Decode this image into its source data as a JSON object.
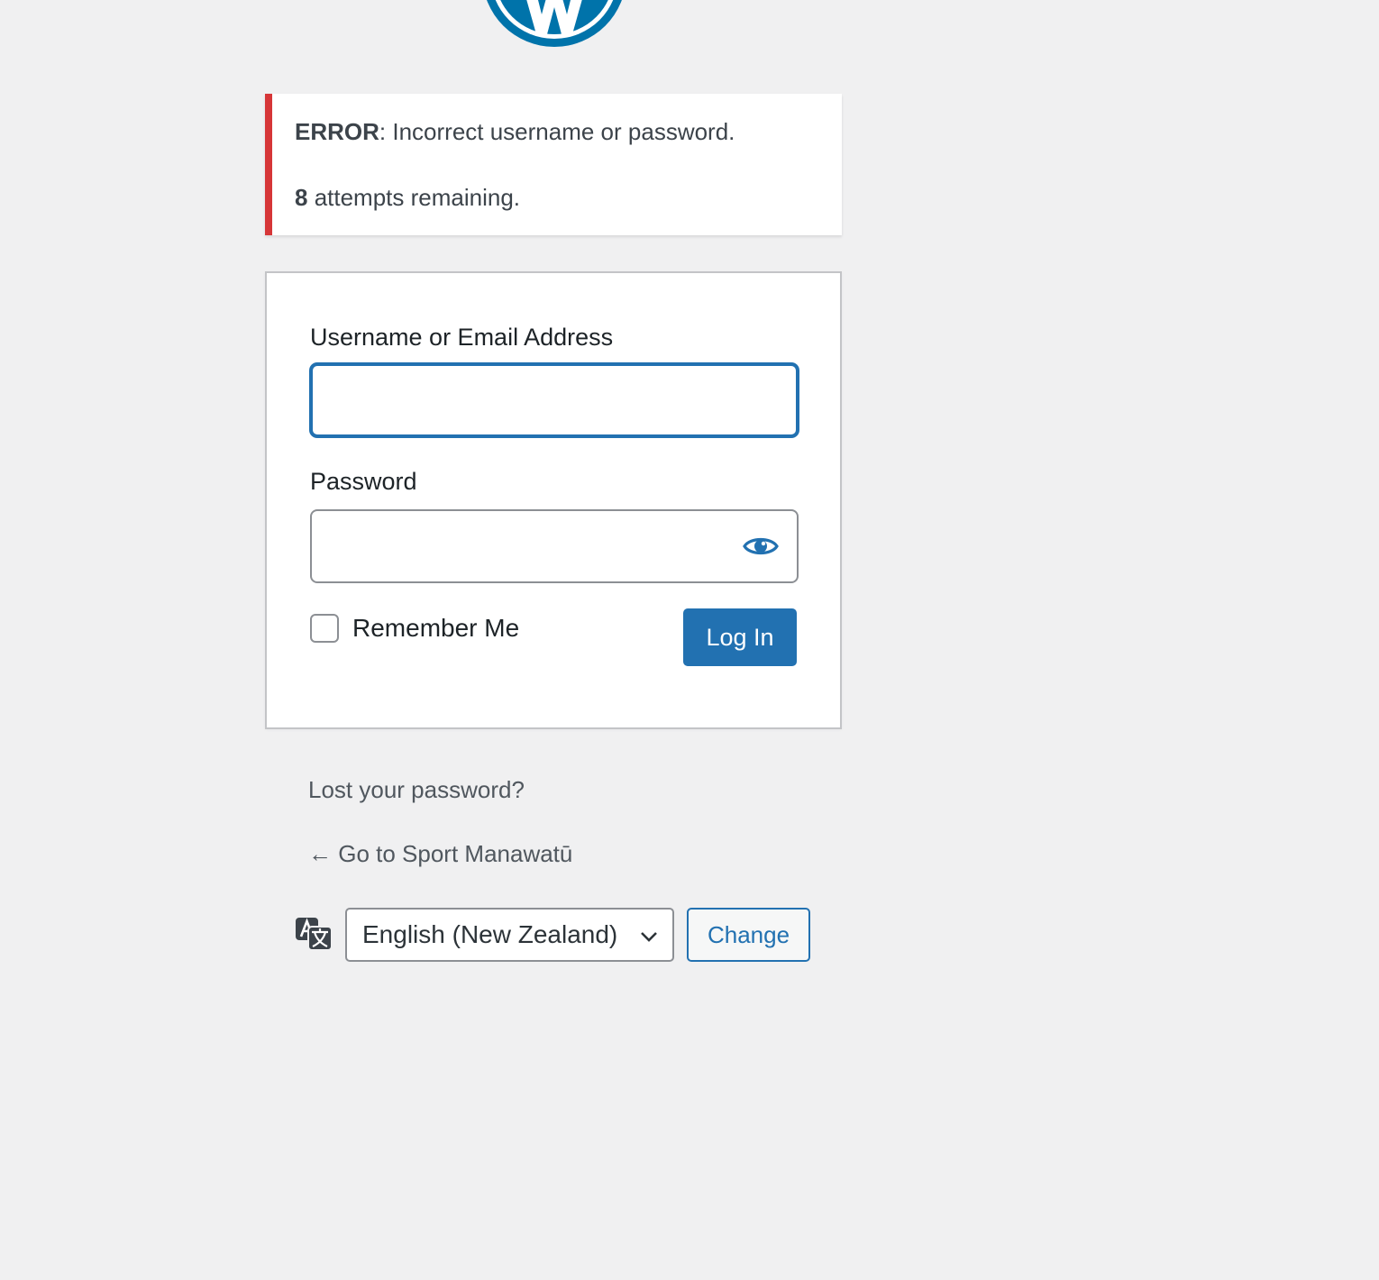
{
  "logo": {
    "icon": "wordpress-logo-icon",
    "color": "#0073aa"
  },
  "notice": {
    "error_label": "ERROR",
    "error_message": ": Incorrect username or password.",
    "attempts_count": "8",
    "attempts_text": " attempts remaining.",
    "accent_color": "#d63638"
  },
  "form": {
    "username_label": "Username or Email Address",
    "username_value": "",
    "password_label": "Password",
    "password_value": "",
    "show_password_icon": "eye-icon",
    "remember_label": "Remember Me",
    "remember_checked": false,
    "login_button": "Log In",
    "accent_color": "#2271b1"
  },
  "links": {
    "lost_password": "Lost your password?",
    "back_to_site": "← Go to Sport Manawatū"
  },
  "language": {
    "icon": "translation-icon",
    "selected": "English (New Zealand)",
    "change_button": "Change"
  }
}
